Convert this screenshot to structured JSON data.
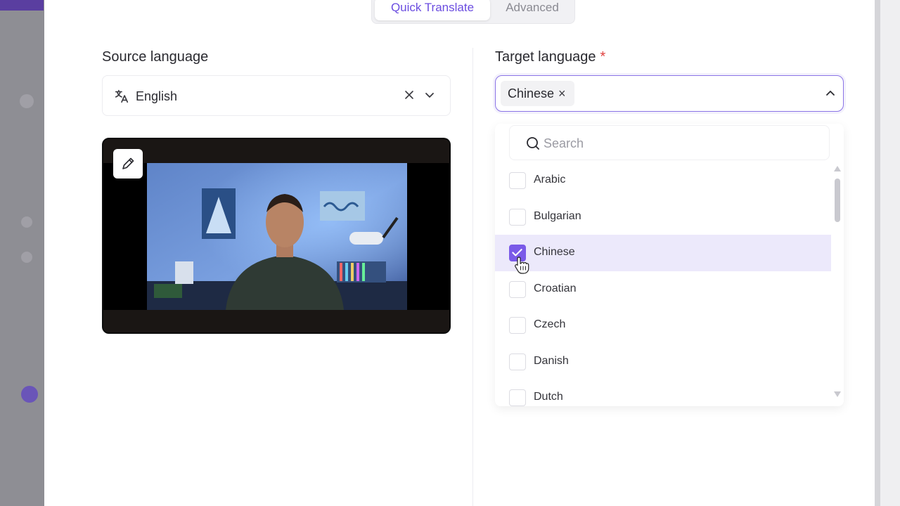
{
  "tabs": [
    {
      "label": "Quick Translate",
      "active": true
    },
    {
      "label": "Advanced",
      "active": false
    }
  ],
  "source": {
    "label": "Source language",
    "value": "English"
  },
  "target": {
    "label": "Target language",
    "required_mark": "*",
    "chips": [
      {
        "label": "Chinese",
        "remove": "×"
      }
    ],
    "search_placeholder": "Search",
    "options": [
      {
        "label": "Arabic",
        "checked": false
      },
      {
        "label": "Bulgarian",
        "checked": false
      },
      {
        "label": "Chinese",
        "checked": true
      },
      {
        "label": "Croatian",
        "checked": false
      },
      {
        "label": "Czech",
        "checked": false
      },
      {
        "label": "Danish",
        "checked": false
      },
      {
        "label": "Dutch",
        "checked": false
      }
    ]
  },
  "colors": {
    "accent": "#7a5ae8",
    "required": "#e0413f",
    "selected_row": "#ece9fb"
  },
  "icons": [
    "translate-icon",
    "close-icon",
    "chevron-down-icon",
    "chevron-up-icon",
    "pencil-icon",
    "search-icon",
    "check-icon",
    "hand-cursor-icon"
  ]
}
